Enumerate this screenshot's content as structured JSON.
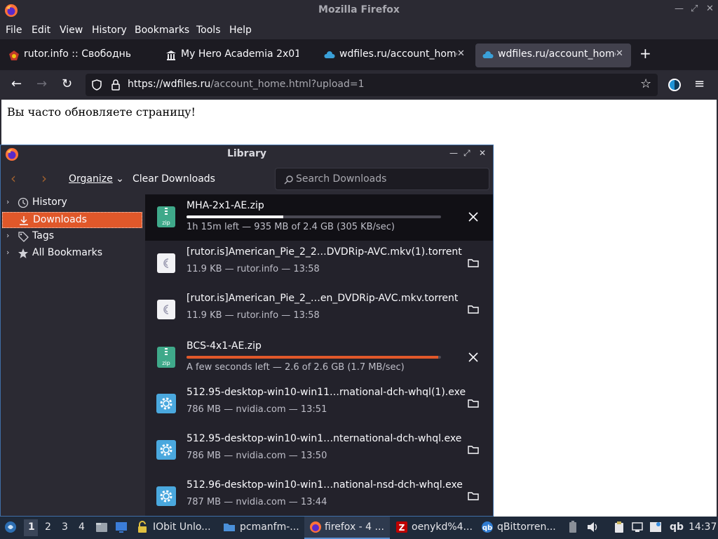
{
  "window": {
    "title": "Mozilla Firefox"
  },
  "menu": [
    "File",
    "Edit",
    "View",
    "History",
    "Bookmarks",
    "Tools",
    "Help"
  ],
  "tabs": [
    {
      "label": "rutor.info :: Свободный т",
      "active": false
    },
    {
      "label": "My Hero Academia 2x01",
      "active": false
    },
    {
      "label": "wdfiles.ru/account_home",
      "active": false
    },
    {
      "label": "wdfiles.ru/account_home",
      "active": true
    }
  ],
  "urlbar": {
    "host": "https://wdfiles.ru",
    "path": "/account_home.html?upload=1"
  },
  "page": {
    "message": "Вы часто обновляете страницу!"
  },
  "library": {
    "title": "Library",
    "toolbar": {
      "organize": "Organize",
      "clear": "Clear Downloads",
      "search_placeholder": "Search Downloads"
    },
    "sidebar": [
      {
        "label": "History",
        "icon": "clock-icon"
      },
      {
        "label": "Downloads",
        "icon": "download-icon",
        "selected": true
      },
      {
        "label": "Tags",
        "icon": "tag-icon"
      },
      {
        "label": "All Bookmarks",
        "icon": "star-icon"
      }
    ],
    "downloads": [
      {
        "name": "MHA-2x1-AE.zip",
        "status": "1h 15m left — 935 MB of 2.4 GB (305 KB/sec)",
        "type": "zip",
        "progress": 0.38,
        "in_progress": true
      },
      {
        "name": "[rutor.is]American_Pie_2_2…DVDRip-AVC.mkv(1).torrent",
        "status": "11.9 KB — rutor.info — 13:58",
        "type": "torrent"
      },
      {
        "name": "[rutor.is]American_Pie_2_…en_DVDRip-AVC.mkv.torrent",
        "status": "11.9 KB — rutor.info — 13:58",
        "type": "torrent"
      },
      {
        "name": "BCS-4x1-AE.zip",
        "status": "A few seconds left — 2.6 of 2.6 GB (1.7 MB/sec)",
        "type": "zip",
        "progress": 0.99,
        "in_progress": true
      },
      {
        "name": "512.95-desktop-win10-win11…rnational-dch-whql(1).exe",
        "status": "786 MB — nvidia.com — 13:51",
        "type": "exe"
      },
      {
        "name": "512.95-desktop-win10-win1…nternational-dch-whql.exe",
        "status": "786 MB — nvidia.com — 13:50",
        "type": "exe"
      },
      {
        "name": "512.96-desktop-win10-win1…national-nsd-dch-whql.exe",
        "status": "787 MB — nvidia.com — 13:44",
        "type": "exe"
      }
    ]
  },
  "taskbar": {
    "workspaces": [
      "1",
      "2",
      "3",
      "4"
    ],
    "apps": [
      {
        "label": "IObit Unlo..."
      },
      {
        "label": "pcmanfm-..."
      },
      {
        "label": "firefox - 4 ..."
      },
      {
        "label": "oenykd%4..."
      },
      {
        "label": "qBittorren..."
      }
    ],
    "tray_label": "qb",
    "clock": "14:37"
  },
  "colors": {
    "accent": "#e0582a",
    "link_blue": "#3f6ea7"
  }
}
